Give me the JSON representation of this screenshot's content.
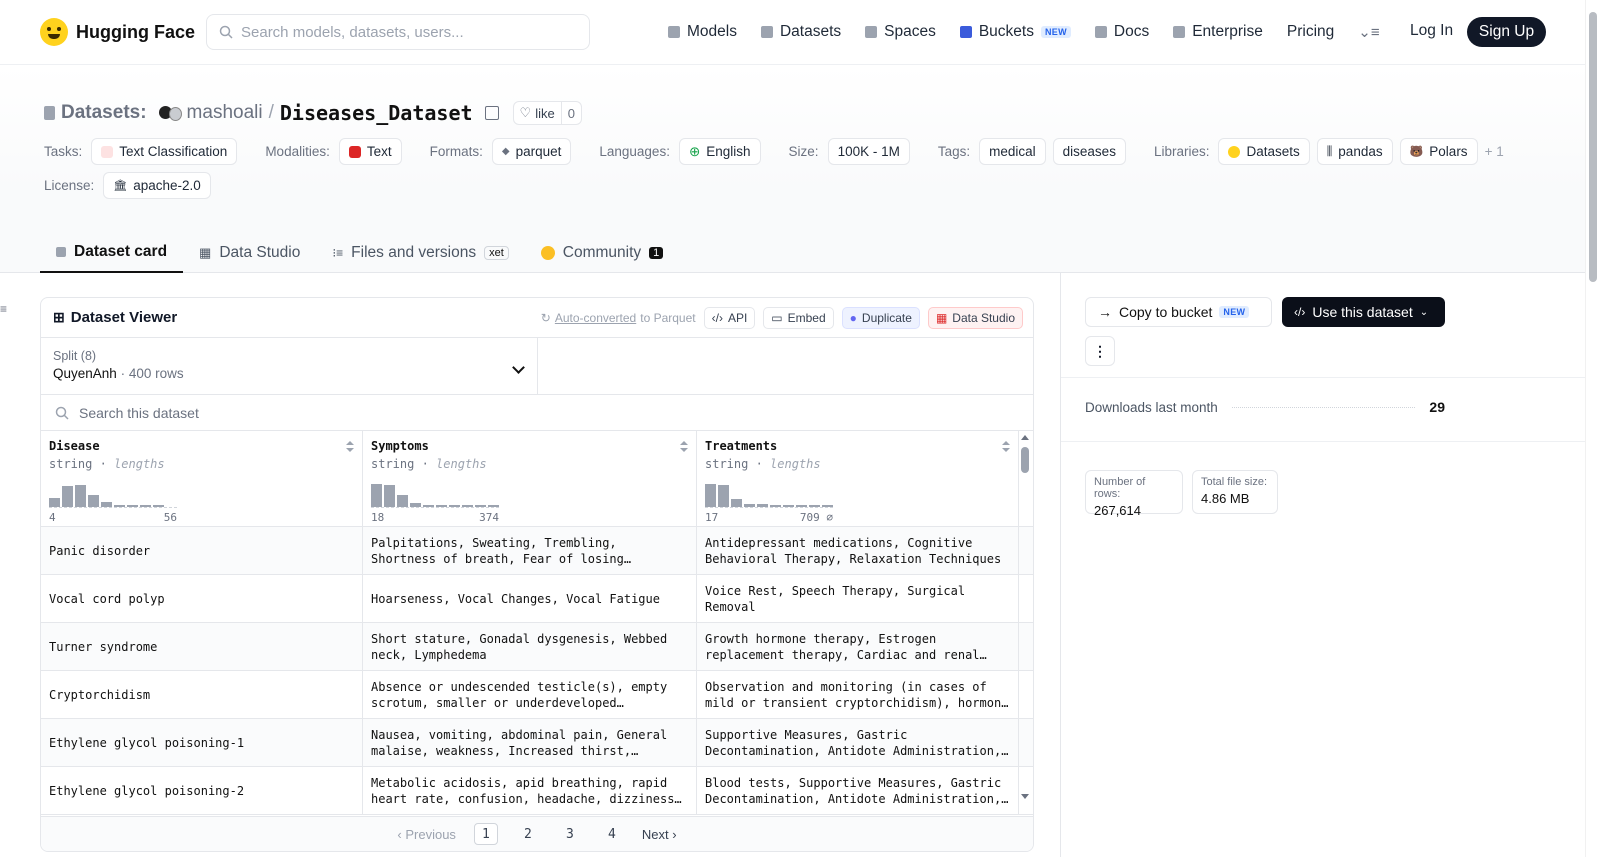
{
  "nav": {
    "brand": "Hugging Face",
    "search_placeholder": "Search models, datasets, users...",
    "links": [
      "Models",
      "Datasets",
      "Spaces",
      "Buckets",
      "Docs",
      "Enterprise",
      "Pricing"
    ],
    "buckets_badge": "NEW",
    "login": "Log In",
    "signup": "Sign Up"
  },
  "repo": {
    "section": "Datasets:",
    "owner": "mashoali",
    "separator": "/",
    "name": "Diseases_Dataset",
    "like_label": "like",
    "like_count": "0"
  },
  "tags": {
    "tasks_label": "Tasks:",
    "tasks": "Text Classification",
    "modalities_label": "Modalities:",
    "modalities": "Text",
    "formats_label": "Formats:",
    "formats": "parquet",
    "languages_label": "Languages:",
    "languages": "English",
    "size_label": "Size:",
    "size": "100K - 1M",
    "tags_label": "Tags:",
    "tag1": "medical",
    "tag2": "diseases",
    "libraries_label": "Libraries:",
    "lib1": "Datasets",
    "lib2": "pandas",
    "lib3": "Polars",
    "more": "+ 1",
    "license_label": "License:",
    "license": "apache-2.0"
  },
  "tabs": {
    "card": "Dataset card",
    "studio": "Data Studio",
    "files": "Files and versions",
    "xet": "xet",
    "community": "Community",
    "community_count": "1"
  },
  "viewer": {
    "title": "Dataset Viewer",
    "auto_link": "Auto-converted",
    "auto_rest": "to Parquet",
    "api": "API",
    "embed": "Embed",
    "duplicate": "Duplicate",
    "data_studio": "Data Studio",
    "split_label": "Split (8)",
    "split_value": "QuyenAnh",
    "split_rows": "400 rows",
    "search_placeholder": "Search this dataset",
    "columns": [
      {
        "name": "Disease",
        "type": "string",
        "stat": "lengths",
        "min": "4",
        "max": "56",
        "hist": [
          0.35,
          0.8,
          0.85,
          0.45,
          0.18,
          0.05,
          0.05,
          0.05,
          0.05
        ]
      },
      {
        "name": "Symptoms",
        "type": "string",
        "stat": "lengths",
        "min": "18",
        "max": "374",
        "hist": [
          0.9,
          0.85,
          0.45,
          0.15,
          0.05,
          0.05,
          0.05,
          0.05,
          0.05,
          0.05
        ]
      },
      {
        "name": "Treatments",
        "type": "string",
        "stat": "lengths",
        "min": "17",
        "max": "709 ⌀",
        "hist": [
          0.9,
          0.85,
          0.3,
          0.12,
          0.12,
          0.08,
          0.06,
          0.05,
          0.05,
          0.05
        ]
      }
    ],
    "rows": [
      [
        "Panic disorder",
        "Palpitations, Sweating, Trembling, Shortness of breath, Fear of losing…",
        "Antidepressant medications, Cognitive Behavioral Therapy, Relaxation Techniques"
      ],
      [
        "Vocal cord polyp",
        "Hoarseness, Vocal Changes, Vocal Fatigue",
        "Voice Rest, Speech Therapy, Surgical Removal"
      ],
      [
        "Turner syndrome",
        "Short stature, Gonadal dysgenesis, Webbed neck, Lymphedema",
        "Growth hormone therapy, Estrogen replacement therapy, Cardiac and renal…"
      ],
      [
        "Cryptorchidism",
        "Absence or undescended testicle(s), empty scrotum, smaller or underdeveloped…",
        "Observation and monitoring (in cases of mild or transient cryptorchidism), hormon…"
      ],
      [
        "Ethylene glycol poisoning-1",
        "Nausea, vomiting, abdominal pain, General malaise, weakness, Increased thirst,…",
        "Supportive Measures, Gastric Decontamination, Antidote Administration,…"
      ],
      [
        "Ethylene glycol poisoning-2",
        "Metabolic acidosis, apid breathing, rapid heart rate, confusion, headache, dizziness…",
        "Blood tests, Supportive Measures, Gastric Decontamination, Antidote Administration,…"
      ]
    ],
    "pager": {
      "prev": "Previous",
      "pages": [
        "1",
        "2",
        "3",
        "4"
      ],
      "next": "Next"
    }
  },
  "sidebar": {
    "copy_bucket": "Copy to bucket",
    "copy_badge": "NEW",
    "use_dataset": "Use this dataset",
    "downloads_label": "Downloads last month",
    "downloads": "29",
    "rows_label": "Number of rows:",
    "rows": "267,614",
    "size_label": "Total file size:",
    "size": "4.86 MB"
  }
}
